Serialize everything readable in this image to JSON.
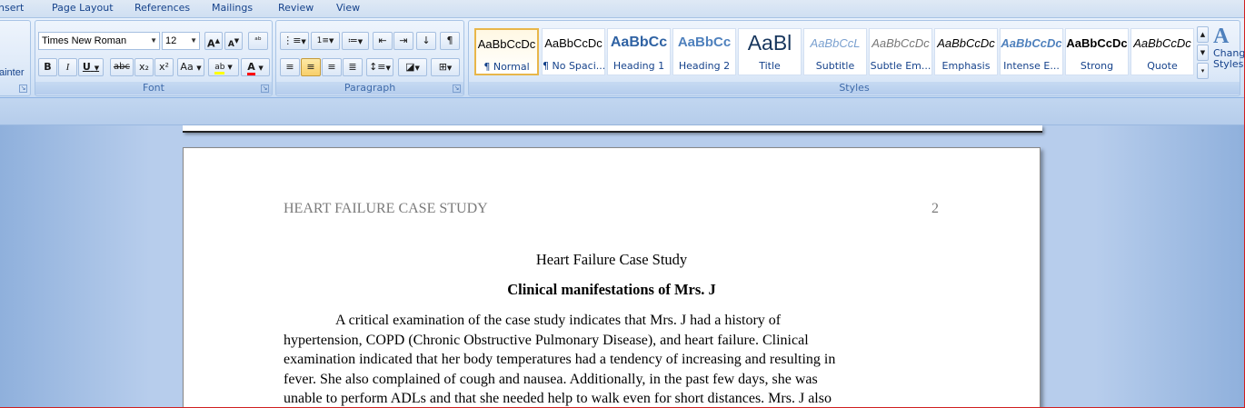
{
  "tabs": [
    "nsert",
    "Page Layout",
    "References",
    "Mailings",
    "Review",
    "View"
  ],
  "clipboard": {
    "partial_label": "ainter"
  },
  "font": {
    "group_label": "Font",
    "family": "Times New Roman",
    "size": "12",
    "grow_glyph": "A",
    "shrink_glyph": "A",
    "clear_glyph": "ᵃᵇ",
    "bold": "B",
    "italic": "I",
    "underline": "U",
    "strike": "abc",
    "subscript": "x₂",
    "superscript": "x²",
    "case": "Aa",
    "highlight": "ab",
    "color_glyph": "A",
    "highlight_color": "#ffff00",
    "font_color": "#ff0000"
  },
  "paragraph": {
    "group_label": "Paragraph",
    "pilcrow": "¶"
  },
  "styles": {
    "group_label": "Styles",
    "items": [
      {
        "sample": "AaBbCcDc",
        "name": "¶ Normal",
        "selected": true
      },
      {
        "sample": "AaBbCcDc",
        "name": "¶ No Spaci..."
      },
      {
        "sample": "AaBbCc",
        "name": "Heading 1"
      },
      {
        "sample": "AaBbCc",
        "name": "Heading 2"
      },
      {
        "sample": "AaBl",
        "name": "Title"
      },
      {
        "sample": "AaBbCcL",
        "name": "Subtitle"
      },
      {
        "sample": "AaBbCcDc",
        "name": "Subtle Em..."
      },
      {
        "sample": "AaBbCcDc",
        "name": "Emphasis"
      },
      {
        "sample": "AaBbCcDc",
        "name": "Intense E..."
      },
      {
        "sample": "AaBbCcDc",
        "name": "Strong"
      },
      {
        "sample": "AaBbCcDc",
        "name": "Quote"
      }
    ],
    "change_styles_label": "Change Styles"
  },
  "document": {
    "header": "HEART FAILURE CASE STUDY",
    "page_number": "2",
    "title": "Heart Failure Case Study",
    "subtitle": "Clinical manifestations of Mrs. J",
    "lines": [
      "A critical examination of the case study indicates that Mrs. J had a history of",
      "hypertension, COPD (Chronic Obstructive Pulmonary Disease), and heart failure. Clinical",
      "examination indicated that her body temperatures had a tendency of increasing and resulting in",
      "fever. She also complained of cough and nausea. Additionally, in the past few days, she was",
      "unable to perform ADLs and that she needed help to walk even for short distances. Mrs. J also"
    ]
  }
}
